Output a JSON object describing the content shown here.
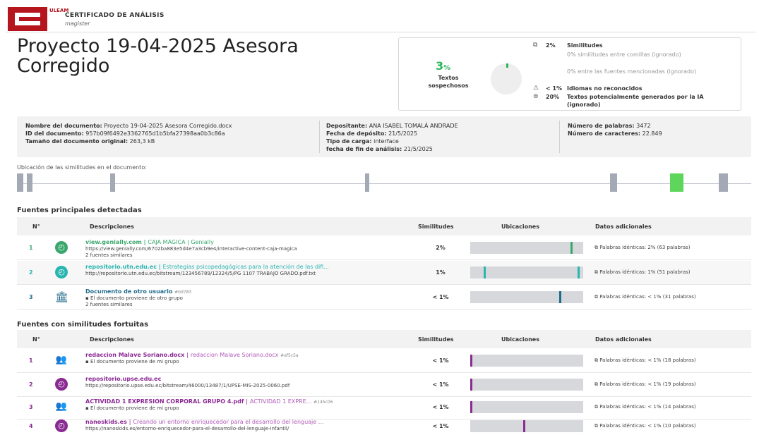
{
  "header": {
    "logo_letters": "C",
    "logo_side_text": "ULEAM",
    "report_title": "CERTIFICADO DE ANÁLISIS",
    "report_subtitle": "magister"
  },
  "document_title": "Proyecto 19-04-2025 Asesora Corregido",
  "summary": {
    "percent": "3",
    "percent_sign": "%",
    "percent_label": "Textos sospechosos",
    "rows": [
      {
        "icon": "similarity-icon",
        "value": "2%",
        "text": "Similitudes"
      },
      {
        "icon": "",
        "value": "",
        "text": "0% similitudes entre comillas (ignorado)"
      },
      {
        "icon": "",
        "value": "",
        "text": "0% entre las fuentes mencionadas (ignorado)"
      },
      {
        "icon": "language-icon",
        "value": "< 1%",
        "text": "Idiomas no reconocidos"
      },
      {
        "icon": "ai-icon",
        "value": "20%",
        "text": "Textos potencialmente generados por la IA (ignorado)"
      }
    ]
  },
  "info": {
    "col1": [
      {
        "label": "Nombre del documento:",
        "value": "Proyecto 19-04-2025 Asesora Corregido.docx"
      },
      {
        "label": "ID del documento:",
        "value": "957b09f6492e3362765d1b5bfa27398aa0b3c86a"
      },
      {
        "label": "Tamaño del documento original:",
        "value": "263,3 kB"
      }
    ],
    "col2": [
      {
        "label": "Depositante:",
        "value": "ANA ISABEL TOMALÁ ANDRADE"
      },
      {
        "label": "Fecha de depósito:",
        "value": "21/5/2025"
      },
      {
        "label": "Tipo de carga:",
        "value": "interface"
      },
      {
        "label": "fecha de fin de análisis:",
        "value": "21/5/2025"
      }
    ],
    "col3": [
      {
        "label": "Número de palabras:",
        "value": "3472"
      },
      {
        "label": "Número de caracteres:",
        "value": "22.849"
      }
    ]
  },
  "location_label": "Ubicación de las similitudes en el documento:",
  "sections": {
    "main_title": "Fuentes principales detectadas",
    "fortuitous_title": "Fuentes con similitudes fortuitas",
    "columns": {
      "num": "N°",
      "desc": "Descripciones",
      "simil": "Similitudes",
      "loc": "Ubicaciones",
      "extra": "Datos adicionales"
    }
  },
  "main_sources": [
    {
      "num": "1",
      "icon": "web-icon",
      "color": "#3aa76d",
      "domain": "view.genially.com",
      "source": "CAJA MÁGICA | Genially",
      "line2": "https://view.genially.com/6702ba883e5d4e7a3cb9e4/interactive-content-caja-magica",
      "line3": "2 fuentes similares",
      "similarity": "2%",
      "marks": [
        0.89
      ],
      "extra": "Palabras idénticas: 2% (63 palabras)"
    },
    {
      "num": "2",
      "icon": "web-icon",
      "color": "#2ab5b0",
      "domain": "repositorio.utn.edu.ec",
      "source": "Estrategias psicopedagógicas para la atención de las difi...",
      "line2": "http://repositorio.utn.edu.ec/bitstream/123456789/12324/5/PG 1107 TRABAJO GRADO.pdf.txt",
      "line3": "",
      "similarity": "1%",
      "marks": [
        0.12,
        0.95
      ],
      "extra": "Palabras idénticas: 1% (51 palabras)"
    },
    {
      "num": "3",
      "icon": "institution-icon",
      "color": "#1f6b8a",
      "domain": "Documento de otro usuario",
      "source": "",
      "tag": "#bd783",
      "line2": "El documento proviene de otro grupo",
      "line3": "2 fuentes similares",
      "similarity": "< 1%",
      "marks": [
        0.79
      ],
      "extra": "Palabras idénticas: < 1% (31 palabras)"
    }
  ],
  "fortuitous_sources": [
    {
      "num": "1",
      "icon": "group-icon",
      "domain": "redaccion Malave Soriano.docx",
      "source": "redaccion Malave Soriano.docx",
      "tag": "#ef5c5a",
      "line2": "El documento proviene de mi grupo",
      "similarity": "< 1%",
      "marks": [
        0.0
      ],
      "extra": "Palabras idénticas: < 1% (18 palabras)"
    },
    {
      "num": "2",
      "icon": "web-icon",
      "domain": "repositorio.upse.edu.ec",
      "source": "",
      "tag": "",
      "line2": "https://repositorio.upse.edu.ec/bitstream/46000/13487/1/UPSE-MIS-2025-0060.pdf",
      "similarity": "< 1%",
      "marks": [
        0.0
      ],
      "extra": "Palabras idénticas: < 1% (19 palabras)"
    },
    {
      "num": "3",
      "icon": "group-icon",
      "domain": "ACTIVIDAD 1 EXPRESIÓN CORPORAL GRUPO 4.pdf",
      "source": "ACTIVIDAD 1 EXPRE...",
      "tag": "#145c06",
      "line2": "El documento proviene de mi grupo",
      "similarity": "< 1%",
      "marks": [
        0.0
      ],
      "extra": "Palabras idénticas: < 1% (14 palabras)"
    },
    {
      "num": "4",
      "icon": "web-icon",
      "domain": "nanoskids.es",
      "source": "Creando un entorno enriquecedor para el desarrollo del lenguaje ...",
      "tag": "",
      "line2": "https://nanoskids.es/entorno-enriquecedor-para-el-desarrollo-del-lenguaje-infantil/",
      "similarity": "< 1%",
      "marks": [
        0.47
      ],
      "extra": "Palabras idénticas: < 1% (10 palabras)"
    }
  ]
}
